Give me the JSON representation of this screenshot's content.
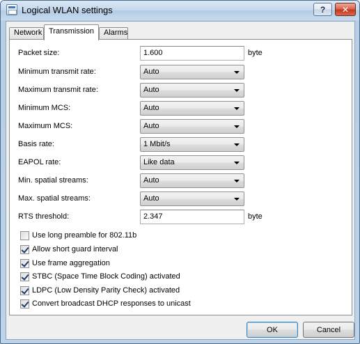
{
  "window": {
    "title": "Logical WLAN settings",
    "help_label": "?",
    "close_label": "✕"
  },
  "tabs": [
    {
      "label": "Network"
    },
    {
      "label": "Transmission"
    },
    {
      "label": "Alarms"
    }
  ],
  "fields": {
    "packet_size": {
      "label": "Packet size:",
      "value": "1.600",
      "unit": "byte"
    },
    "min_transmit_rate": {
      "label": "Minimum transmit rate:",
      "value": "Auto"
    },
    "max_transmit_rate": {
      "label": "Maximum transmit rate:",
      "value": "Auto"
    },
    "min_mcs": {
      "label": "Minimum MCS:",
      "value": "Auto"
    },
    "max_mcs": {
      "label": "Maximum MCS:",
      "value": "Auto"
    },
    "basis_rate": {
      "label": "Basis rate:",
      "value": "1 Mbit/s"
    },
    "eapol_rate": {
      "label": "EAPOL rate:",
      "value": "Like data"
    },
    "min_spatial": {
      "label": "Min. spatial streams:",
      "value": "Auto"
    },
    "max_spatial": {
      "label": "Max. spatial streams:",
      "value": "Auto"
    },
    "rts_threshold": {
      "label": "RTS threshold:",
      "value": "2.347",
      "unit": "byte"
    }
  },
  "checkboxes": {
    "long_preamble": {
      "label": "Use long preamble for 802.11b",
      "checked": false
    },
    "short_guard": {
      "label": "Allow short guard interval",
      "checked": true
    },
    "frame_aggregation": {
      "label": "Use frame aggregation",
      "checked": true
    },
    "stbc": {
      "label": "STBC (Space Time Block Coding) activated",
      "checked": true
    },
    "ldpc": {
      "label": "LDPC (Low Density Parity Check) activated",
      "checked": true
    },
    "dhcp_unicast": {
      "label": "Convert broadcast DHCP responses to unicast",
      "checked": true
    }
  },
  "buttons": {
    "ok": "OK",
    "cancel": "Cancel"
  }
}
